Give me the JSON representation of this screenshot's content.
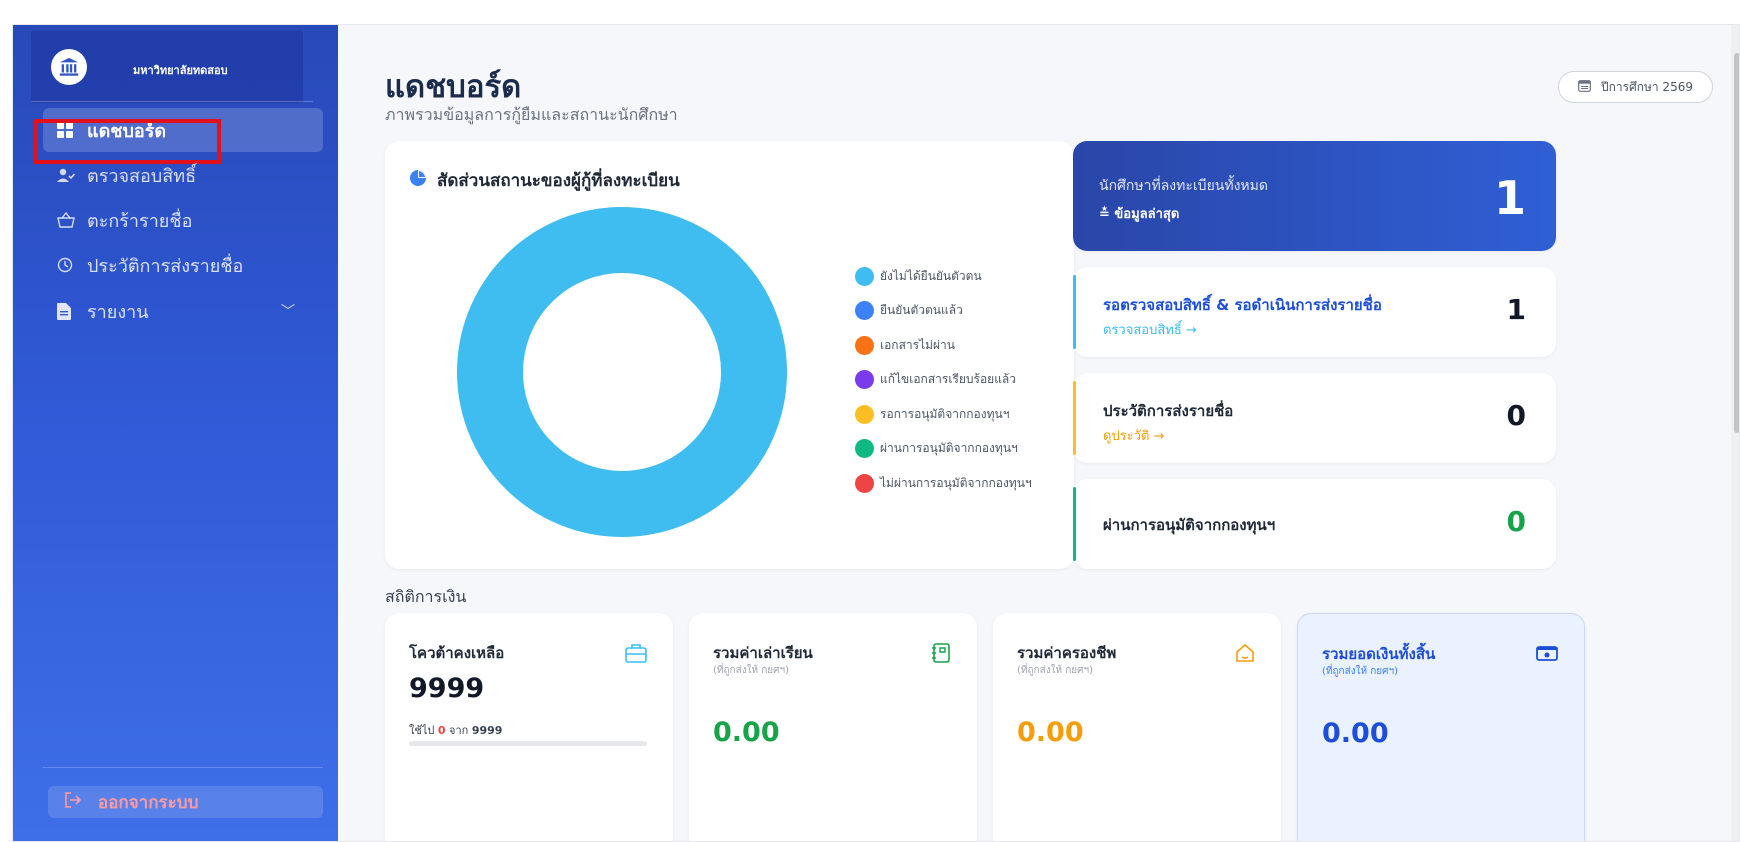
{
  "app": {
    "org_name": "มหาวิทยาลัยทดสอบ"
  },
  "sidebar": {
    "items": [
      {
        "label": "แดชบอร์ด",
        "icon": "grid-icon",
        "active": true
      },
      {
        "label": "ตรวจสอบสิทธิ์",
        "icon": "user-check-icon"
      },
      {
        "label": "ตะกร้ารายชื่อ",
        "icon": "basket-icon"
      },
      {
        "label": "ประวัติการส่งรายชื่อ",
        "icon": "clock-icon"
      },
      {
        "label": "รายงาน",
        "icon": "document-icon",
        "has_submenu": true
      }
    ],
    "logout_label": "ออกจากระบบ"
  },
  "header": {
    "title": "แดชบอร์ด",
    "subtitle": "ภาพรวมข้อมูลการกู้ยืมและสถานะนักศึกษา",
    "year_label": "ปีการศึกษา 2569"
  },
  "chart": {
    "title": "สัดส่วนสถานะของผู้กู้ที่ลงทะเบียน",
    "legend": [
      {
        "label": "ยังไม่ได้ยืนยันตัวตน",
        "color": "#3fbcf0"
      },
      {
        "label": "ยืนยันตัวตนแล้ว",
        "color": "#3b82f6"
      },
      {
        "label": "เอกสารไม่ผ่าน",
        "color": "#f97316"
      },
      {
        "label": "แก้ไขเอกสารเรียบร้อยแล้ว",
        "color": "#7c3aed"
      },
      {
        "label": "รอการอนุมัติจากกองทุนฯ",
        "color": "#fbbf24"
      },
      {
        "label": "ผ่านการอนุมัติจากกองทุนฯ",
        "color": "#10b981"
      },
      {
        "label": "ไม่ผ่านการอนุมัติจากกองทุนฯ",
        "color": "#ef4444"
      }
    ]
  },
  "chart_data": {
    "type": "pie",
    "categories": [
      "ยังไม่ได้ยืนยันตัวตน",
      "ยืนยันตัวตนแล้ว",
      "เอกสารไม่ผ่าน",
      "แก้ไขเอกสารเรียบร้อยแล้ว",
      "รอการอนุมัติจากกองทุนฯ",
      "ผ่านการอนุมัติจากกองทุนฯ",
      "ไม่ผ่านการอนุมัติจากกองทุนฯ"
    ],
    "values": [
      1,
      0,
      0,
      0,
      0,
      0,
      0
    ],
    "title": "สัดส่วนสถานะของผู้กู้ที่ลงทะเบียน",
    "legend_position": "right"
  },
  "stats": {
    "total": {
      "label": "นักศึกษาที่ลงทะเบียนทั้งหมด",
      "sub": "ข้อมูลล่าสุด",
      "value": "1"
    },
    "pending": {
      "label": "รอตรวจสอบสิทธิ์ & รอดำเนินการส่งรายชื่อ",
      "link": "ตรวจสอบสิทธิ์ →",
      "value": "1",
      "color": "#38bdf8"
    },
    "history": {
      "label": "ประวัติการส่งรายชื่อ",
      "link": "ดูประวัติ →",
      "value": "0",
      "color": "#fbbf24"
    },
    "approved": {
      "label": "ผ่านการอนุมัติจากกองทุนฯ",
      "value": "0",
      "color": "#10b981"
    }
  },
  "finance": {
    "section_title": "สถิติการเงิน",
    "quota": {
      "title": "โควต้าคงเหลือ",
      "value": "9999",
      "used_prefix": "ใช้ไป",
      "used": "0",
      "used_mid": "จาก",
      "used_total": "9999"
    },
    "tuition": {
      "title": "รวมค่าเล่าเรียน",
      "sub": "(ที่ถูกส่งให้ กยศฯ)",
      "value": "0.00",
      "color": "#16a34a"
    },
    "living": {
      "title": "รวมค่าครองชีพ",
      "sub": "(ที่ถูกส่งให้ กยศฯ)",
      "value": "0.00",
      "color": "#f59e0b"
    },
    "total": {
      "title": "รวมยอดเงินทั้งสิ้น",
      "sub": "(ที่ถูกส่งให้ กยศฯ)",
      "value": "0.00",
      "color": "#1d4ed8"
    }
  }
}
